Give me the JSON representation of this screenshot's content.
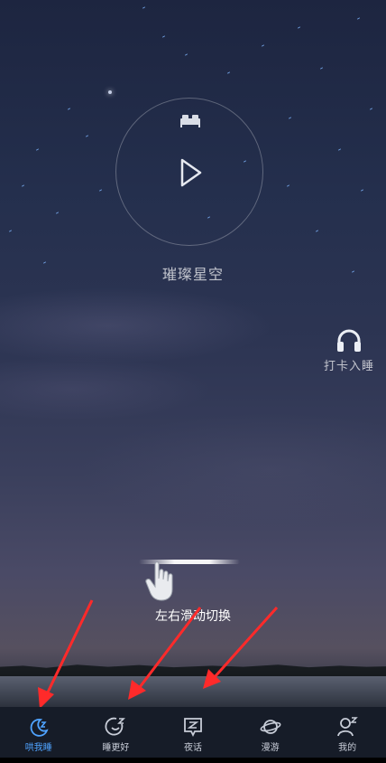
{
  "player": {
    "track_title": "璀璨星空",
    "icons": {
      "top": "bed-icon",
      "center": "play-icon"
    }
  },
  "side_action": {
    "label": "打卡入睡",
    "icon": "headphones-icon"
  },
  "swipe_hint": {
    "text": "左右滑动切换",
    "icon": "hand-swipe-icon"
  },
  "tabs": [
    {
      "label": "哄我睡",
      "icon": "moon-z-icon",
      "active": true
    },
    {
      "label": "睡更好",
      "icon": "smile-z-icon",
      "active": false
    },
    {
      "label": "夜话",
      "icon": "chat-z-icon",
      "active": false
    },
    {
      "label": "漫游",
      "icon": "planet-icon",
      "active": false
    },
    {
      "label": "我的",
      "icon": "person-z-icon",
      "active": false
    }
  ],
  "colors": {
    "active_tab": "#4fa3ff",
    "inactive_tab": "#c8cdd8",
    "annotation_arrow": "#ff2a2a"
  }
}
